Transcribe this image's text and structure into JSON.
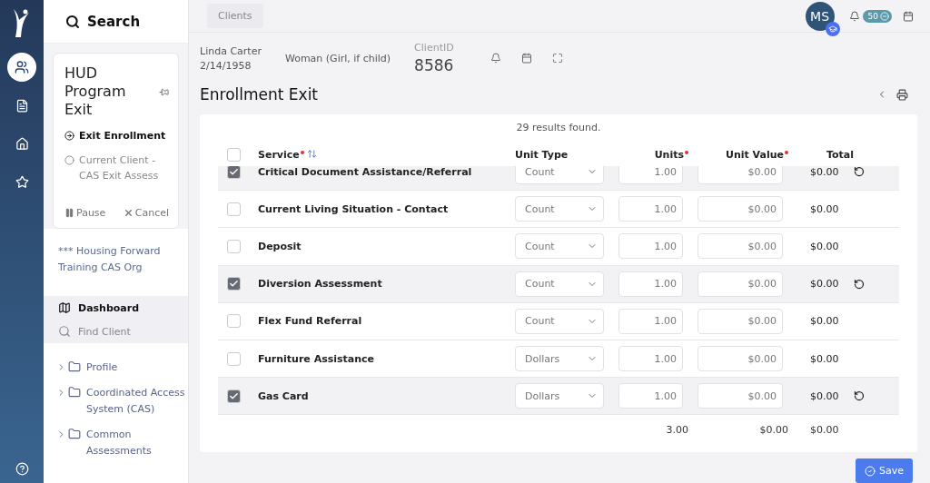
{
  "rail": {
    "items": [
      {
        "kind": "people",
        "selected": true
      },
      {
        "kind": "file",
        "selected": false
      },
      {
        "kind": "home",
        "selected": false
      },
      {
        "kind": "star",
        "selected": false
      }
    ]
  },
  "sidebar": {
    "search": "Search",
    "workflow": {
      "title": "HUD Program Exit",
      "steps": [
        {
          "label": "Exit Enrollment",
          "current": true
        },
        {
          "label": "Current Client - CAS Exit Assess",
          "current": false
        }
      ],
      "pause": "Pause",
      "cancel": "Cancel"
    },
    "org": "*** Housing Forward Training CAS Org",
    "nav": [
      {
        "kind": "map",
        "label": "Dashboard",
        "selected": true
      },
      {
        "kind": "search",
        "label": "Find Client",
        "selected": false
      }
    ],
    "folders": [
      "Profile",
      "Coordinated Access System (CAS)",
      "Common Assessments"
    ]
  },
  "topbar": {
    "breadcrumb": "Clients",
    "avatar": "MS",
    "notifications": "50"
  },
  "client": {
    "name": "Linda Carter",
    "dob": "2/14/1958",
    "gender": "Woman (Girl, if child)",
    "id_label": "ClientID",
    "id": "8586"
  },
  "title": "Enrollment Exit",
  "table": {
    "results": "29 results found.",
    "select_all_checked": false,
    "columns": [
      {
        "label": "Service",
        "required": true
      },
      {
        "label": "Unit Type",
        "required": false
      },
      {
        "label": "Units",
        "required": true
      },
      {
        "label": "Unit Value",
        "required": true
      },
      {
        "label": "Total",
        "required": false
      }
    ],
    "rows": [
      {
        "service": "Critical Document Assistance/Referral",
        "unit_type": "Count",
        "units": "1.00",
        "unit_value": "$0.00",
        "total": "$0.00",
        "checked": true
      },
      {
        "service": "Current Living Situation - Contact",
        "unit_type": "Count",
        "units": "1.00",
        "unit_value": "$0.00",
        "total": "$0.00",
        "checked": false
      },
      {
        "service": "Deposit",
        "unit_type": "Count",
        "units": "1.00",
        "unit_value": "$0.00",
        "total": "$0.00",
        "checked": false
      },
      {
        "service": "Diversion Assessment",
        "unit_type": "Count",
        "units": "1.00",
        "unit_value": "$0.00",
        "total": "$0.00",
        "checked": true
      },
      {
        "service": "Flex Fund Referral",
        "unit_type": "Count",
        "units": "1.00",
        "unit_value": "$0.00",
        "total": "$0.00",
        "checked": false
      },
      {
        "service": "Furniture Assistance",
        "unit_type": "Dollars",
        "units": "1.00",
        "unit_value": "$0.00",
        "total": "$0.00",
        "checked": false
      },
      {
        "service": "Gas Card",
        "unit_type": "Dollars",
        "units": "1.00",
        "unit_value": "$0.00",
        "total": "$0.00",
        "checked": true
      }
    ],
    "totals": {
      "units": "3.00",
      "unit_value": "$0.00",
      "total": "$0.00"
    }
  },
  "save": "Save"
}
